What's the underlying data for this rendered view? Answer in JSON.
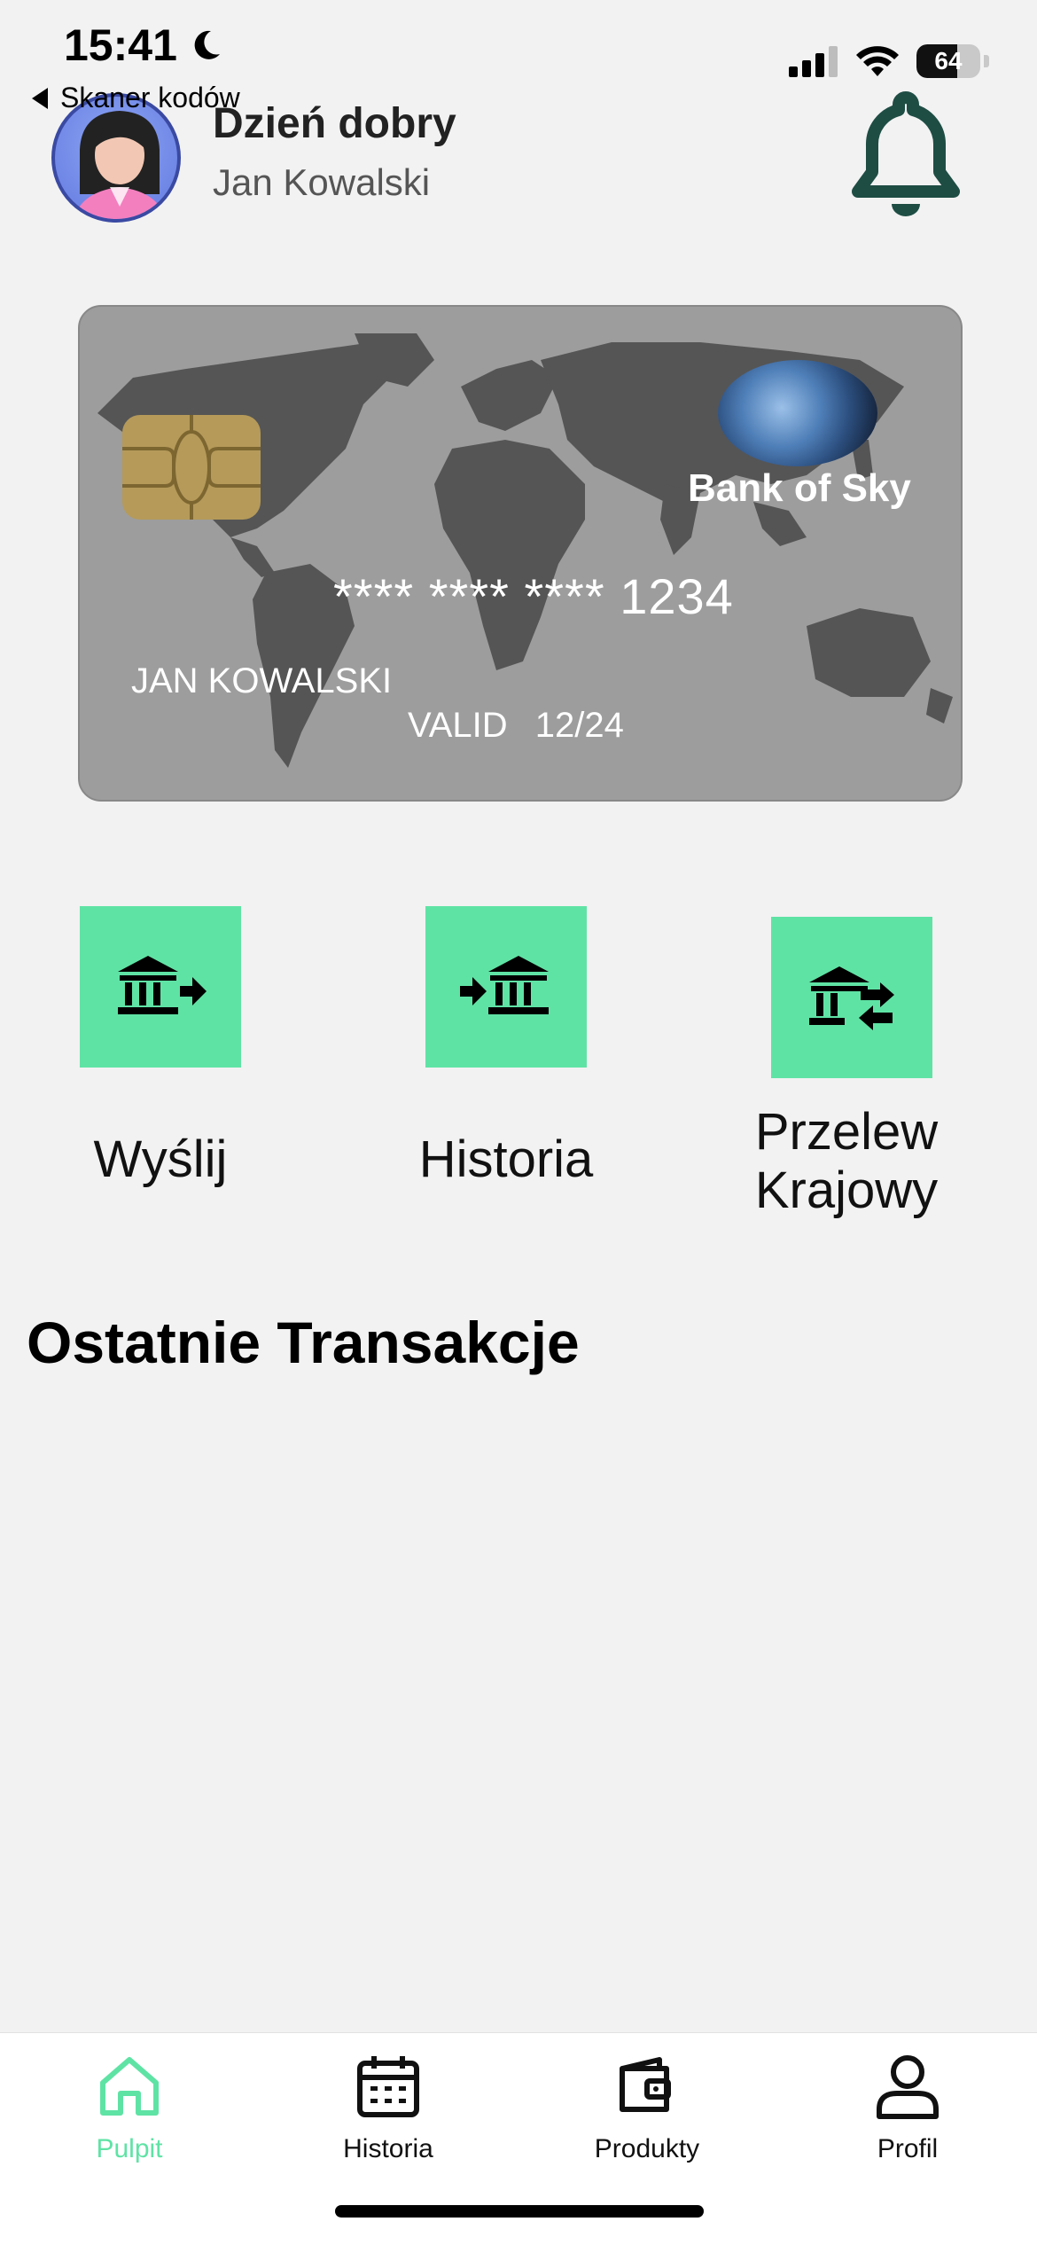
{
  "status_bar": {
    "time": "15:41",
    "back_app_label": "Skaner kodów",
    "battery_level": "64",
    "battery_fraction": 0.64
  },
  "header": {
    "greeting": "Dzień dobry",
    "user_name": "Jan Kowalski"
  },
  "card": {
    "bank_name": "Bank of Sky",
    "number_masked": "**** **** **** 1234",
    "holder": "JAN KOWALSKI",
    "valid_label": "VALID",
    "valid_date": "12/24"
  },
  "actions": [
    {
      "label": "Wyślij",
      "icon": "bank-send-icon"
    },
    {
      "label": "Historia",
      "icon": "bank-receive-icon"
    },
    {
      "label_line1": "Przelew",
      "label_line2": "Krajowy",
      "icon": "bank-transfer-icon"
    }
  ],
  "section": {
    "title": "Ostatnie Transakcje"
  },
  "bottom_nav": {
    "active_color": "#5fe3a5",
    "items": [
      {
        "label": "Pulpit",
        "icon": "home-icon",
        "active": true
      },
      {
        "label": "Historia",
        "icon": "calendar-icon",
        "active": false
      },
      {
        "label": "Produkty",
        "icon": "wallet-icon",
        "active": false
      },
      {
        "label": "Profil",
        "icon": "user-icon",
        "active": false
      }
    ]
  }
}
